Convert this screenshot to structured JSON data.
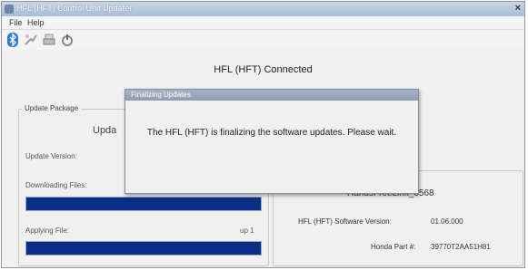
{
  "window": {
    "title": "HFL (HFT) Control Unit Updater",
    "close_glyph": "×"
  },
  "menu": {
    "file": "File",
    "help": "Help"
  },
  "toolbar": {
    "icons": [
      "bluetooth-icon",
      "signal-icon",
      "printer-icon",
      "power-icon"
    ]
  },
  "status": {
    "connected_text": "HFL (HFT) Connected"
  },
  "update_package": {
    "legend": "Update Package",
    "package_name": "Upda",
    "update_version_label": "Update Version:",
    "downloading_label": "Downloading Files:",
    "applying_label": "Applying File:",
    "applying_count": "up 1",
    "download_progress": 1.0,
    "apply_progress": 1.0
  },
  "device_info": {
    "device_name": "HandsFreeLink_0568",
    "software_version_label": "HFL (HFT) Software Version:",
    "software_version_value": "01.06.000",
    "part_number_label": "Honda Part #:",
    "part_number_value": "39770T2AA51H81"
  },
  "dialog": {
    "title": "Finalizing Updates",
    "message": "The HFL (HFT) is finalizing the software updates. Please wait."
  },
  "colors": {
    "progress_fill": "#0a2d86",
    "window_bg": "#f0f0f0",
    "titlebar": "#a9bdd5"
  }
}
